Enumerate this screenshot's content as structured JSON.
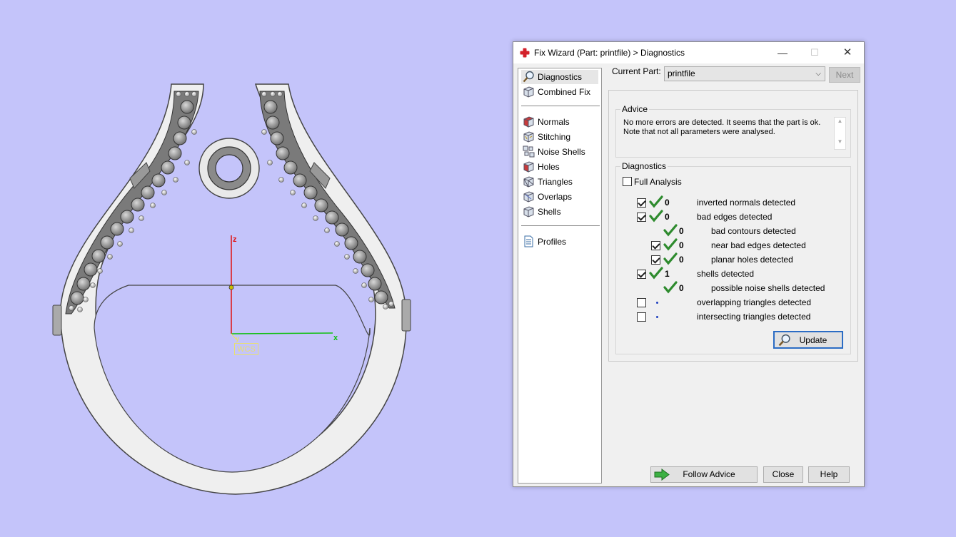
{
  "viewport": {
    "axis_z": "z",
    "axis_x": "x",
    "axis_y": "y",
    "wcs_label": "WCS"
  },
  "dialog": {
    "title": "Fix Wizard (Part: printfile) > Diagnostics",
    "window_buttons": {
      "minimize": "—",
      "maximize": "☐",
      "close": "✕"
    },
    "nav_groups": [
      [
        {
          "label": "Diagnostics",
          "icon": "magnifier-icon",
          "selected": true
        },
        {
          "label": "Combined Fix",
          "icon": "cube-icon"
        }
      ],
      [
        {
          "label": "Normals",
          "icon": "normals-cube-icon"
        },
        {
          "label": "Stitching",
          "icon": "stitching-cube-icon"
        },
        {
          "label": "Noise Shells",
          "icon": "noise-shells-icon"
        },
        {
          "label": "Holes",
          "icon": "holes-cube-icon"
        },
        {
          "label": "Triangles",
          "icon": "triangles-cube-icon"
        },
        {
          "label": "Overlaps",
          "icon": "overlaps-cube-icon"
        },
        {
          "label": "Shells",
          "icon": "shells-cube-icon"
        }
      ],
      [
        {
          "label": "Profiles",
          "icon": "document-icon"
        }
      ]
    ],
    "current_part_label": "Current Part:",
    "current_part_value": "printfile",
    "next_label": "Next",
    "advice": {
      "title": "Advice",
      "line1": "No more errors are detected. It seems that the part is ok.",
      "line2": "Note that not all parameters were analysed."
    },
    "diagnostics": {
      "title": "Diagnostics",
      "full_analysis_label": "Full Analysis",
      "full_analysis_checked": false,
      "rows": [
        {
          "checkbox": true,
          "checked": true,
          "status": "ok",
          "count": "0",
          "label": "inverted normals detected",
          "indent": 0
        },
        {
          "checkbox": true,
          "checked": true,
          "status": "ok",
          "count": "0",
          "label": "bad edges detected",
          "indent": 0
        },
        {
          "checkbox": false,
          "checked": false,
          "status": "ok",
          "count": "0",
          "label": "bad contours detected",
          "indent": 1
        },
        {
          "checkbox": true,
          "checked": true,
          "status": "ok",
          "count": "0",
          "label": "near bad edges detected",
          "indent": 1
        },
        {
          "checkbox": true,
          "checked": true,
          "status": "ok",
          "count": "0",
          "label": "planar holes detected",
          "indent": 1
        },
        {
          "checkbox": true,
          "checked": true,
          "status": "ok",
          "count": "1",
          "label": "shells detected",
          "indent": 0
        },
        {
          "checkbox": false,
          "checked": false,
          "status": "ok",
          "count": "0",
          "label": "possible noise shells detected",
          "indent": 1
        },
        {
          "checkbox": true,
          "checked": false,
          "status": "none",
          "count": "",
          "label": "overlapping triangles detected",
          "indent": 0
        },
        {
          "checkbox": true,
          "checked": false,
          "status": "none",
          "count": "",
          "label": "intersecting triangles detected",
          "indent": 0
        }
      ],
      "update_label": "Update"
    },
    "follow_advice_label": "Follow Advice",
    "close_label": "Close",
    "help_label": "Help",
    "colors": {
      "ok_green": "#2e8b2e",
      "pending_dot": "#1e3fbf",
      "focus_blue": "#2b6cc4"
    }
  }
}
